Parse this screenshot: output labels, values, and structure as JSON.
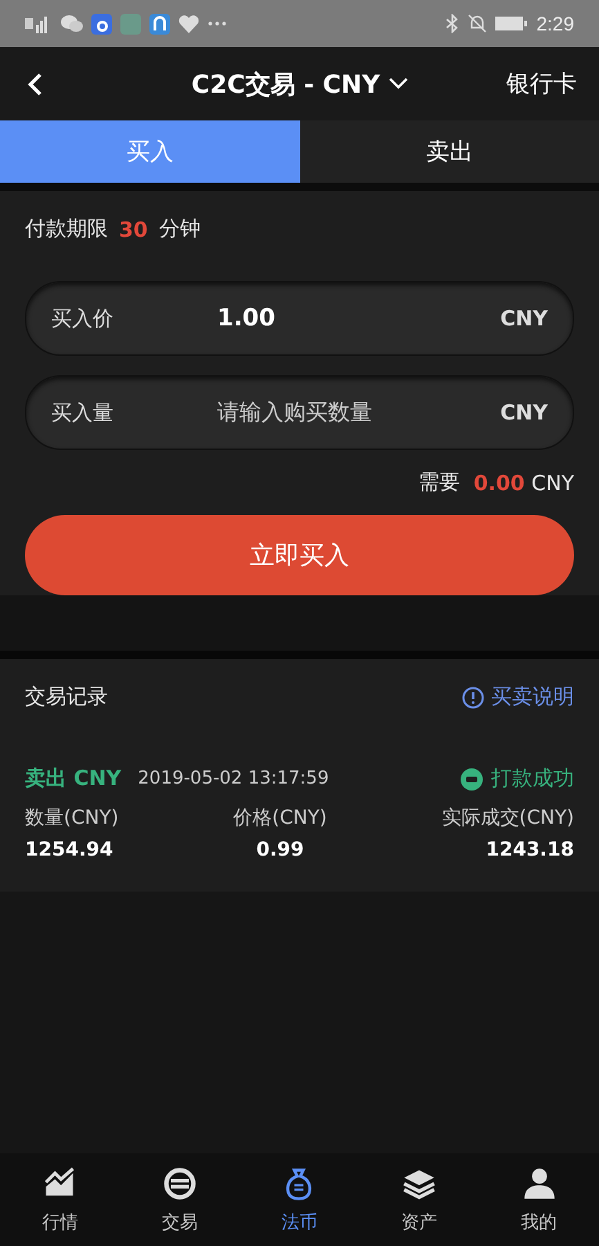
{
  "status_bar": {
    "time": "2:29"
  },
  "header": {
    "title": "C2C交易 - CNY",
    "action": "银行卡"
  },
  "tabs": [
    {
      "label": "买入",
      "selected": true
    },
    {
      "label": "卖出",
      "selected": false
    }
  ],
  "payment_limit": {
    "label": "付款期限",
    "value": "30",
    "unit": "分钟"
  },
  "fields": [
    {
      "label": "买入价",
      "value": "1.00",
      "unit": "CNY"
    },
    {
      "label": "买入量",
      "placeholder": "请输入购买数量",
      "unit": "CNY"
    }
  ],
  "total": {
    "label": "需要",
    "value": "0.00",
    "unit": "CNY"
  },
  "submit": "立即买入",
  "records": {
    "title": "交易记录",
    "help_link": "买卖说明",
    "items": [
      {
        "type": "卖出 CNY",
        "time": "2019-05-02 13:17:59",
        "status": "打款成功",
        "columns": [
          {
            "label": "数量(CNY)",
            "value": "1254.94"
          },
          {
            "label": "价格(CNY)",
            "value": "0.99"
          },
          {
            "label": "实际成交(CNY)",
            "value": "1243.18"
          }
        ]
      }
    ]
  },
  "nav": [
    {
      "label": "行情",
      "selected": false
    },
    {
      "label": "交易",
      "selected": false
    },
    {
      "label": "法币",
      "selected": true
    },
    {
      "label": "资产",
      "selected": false
    },
    {
      "label": "我的",
      "selected": false
    }
  ]
}
